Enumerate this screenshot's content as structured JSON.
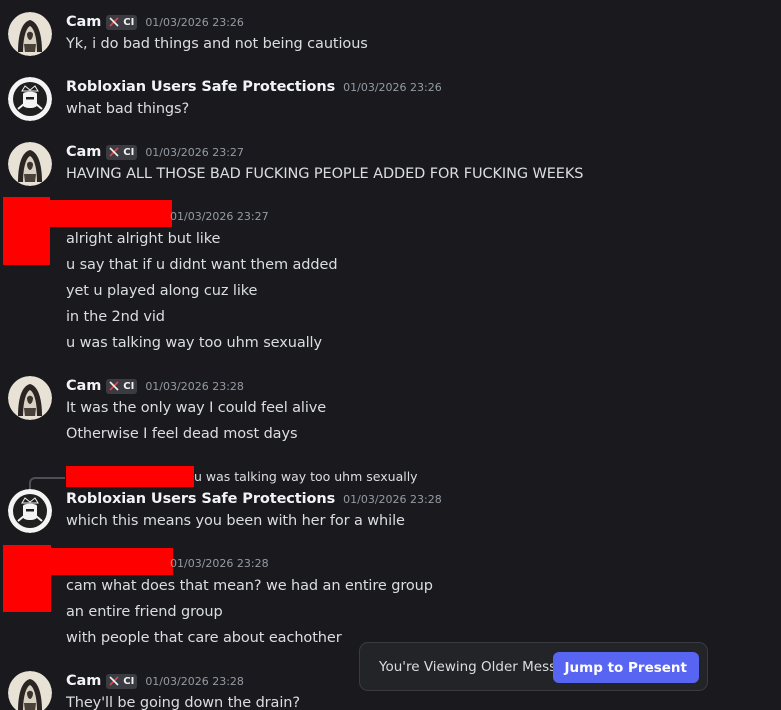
{
  "messages": [
    {
      "author": "Cam",
      "badge": "CI",
      "timestamp": "01/03/2026 23:26",
      "lines": [
        "Yk, i do bad things and not being cautious"
      ]
    },
    {
      "author": "Robloxian Users Safe Protections",
      "timestamp": "01/03/2026 23:26",
      "lines": [
        "what bad things?"
      ]
    },
    {
      "author": "Cam",
      "badge": "CI",
      "timestamp": "01/03/2026 23:27",
      "lines": [
        "HAVING ALL THOSE BAD FUCKING PEOPLE ADDED FOR FUCKING WEEKS"
      ]
    },
    {
      "author": "",
      "timestamp": "01/03/2026 23:27",
      "timestamp_visible": "01/03/2026 23:27",
      "lines": [
        "alright alright but like",
        "u say that if u didnt want them added",
        "yet u played along cuz like",
        "in the 2nd vid",
        "u was talking way too uhm sexually"
      ]
    },
    {
      "author": "Cam",
      "badge": "CI",
      "timestamp": "01/03/2026 23:28",
      "lines": [
        "It was the only way I could feel alive",
        "Otherwise I feel dead most days"
      ]
    },
    {
      "reply_preview": "u was talking way too uhm sexually",
      "author": "Robloxian Users Safe Protections",
      "timestamp": "01/03/2026 23:28",
      "lines": [
        "which this means you been with her for a while"
      ]
    },
    {
      "author": "",
      "timestamp": "01/03/2026 23:28",
      "timestamp_visible": "01/03/2026 23:28",
      "lines": [
        "cam what does that mean? we had an entire group",
        "an entire friend group",
        "with people that care about eachother"
      ]
    },
    {
      "author": "Cam",
      "badge": "CI",
      "timestamp": "01/03/2026 23:28",
      "lines": [
        "They'll be going down the drain?"
      ]
    }
  ],
  "banner": {
    "text": "You're Viewing Older Messages",
    "button_label": "Jump to Present"
  },
  "colors": {
    "background": "#1a1a1e",
    "username": "#f2f3f5",
    "message_text": "#dbdee1",
    "timestamp": "#949ba4",
    "accent": "#5865f2",
    "redaction": "#ff0000"
  },
  "icons": {
    "badge": "crossed-swords-icon",
    "cam_avatar": "hooded-figure-avatar",
    "rusp_avatar": "knight-helmet-avatar"
  }
}
